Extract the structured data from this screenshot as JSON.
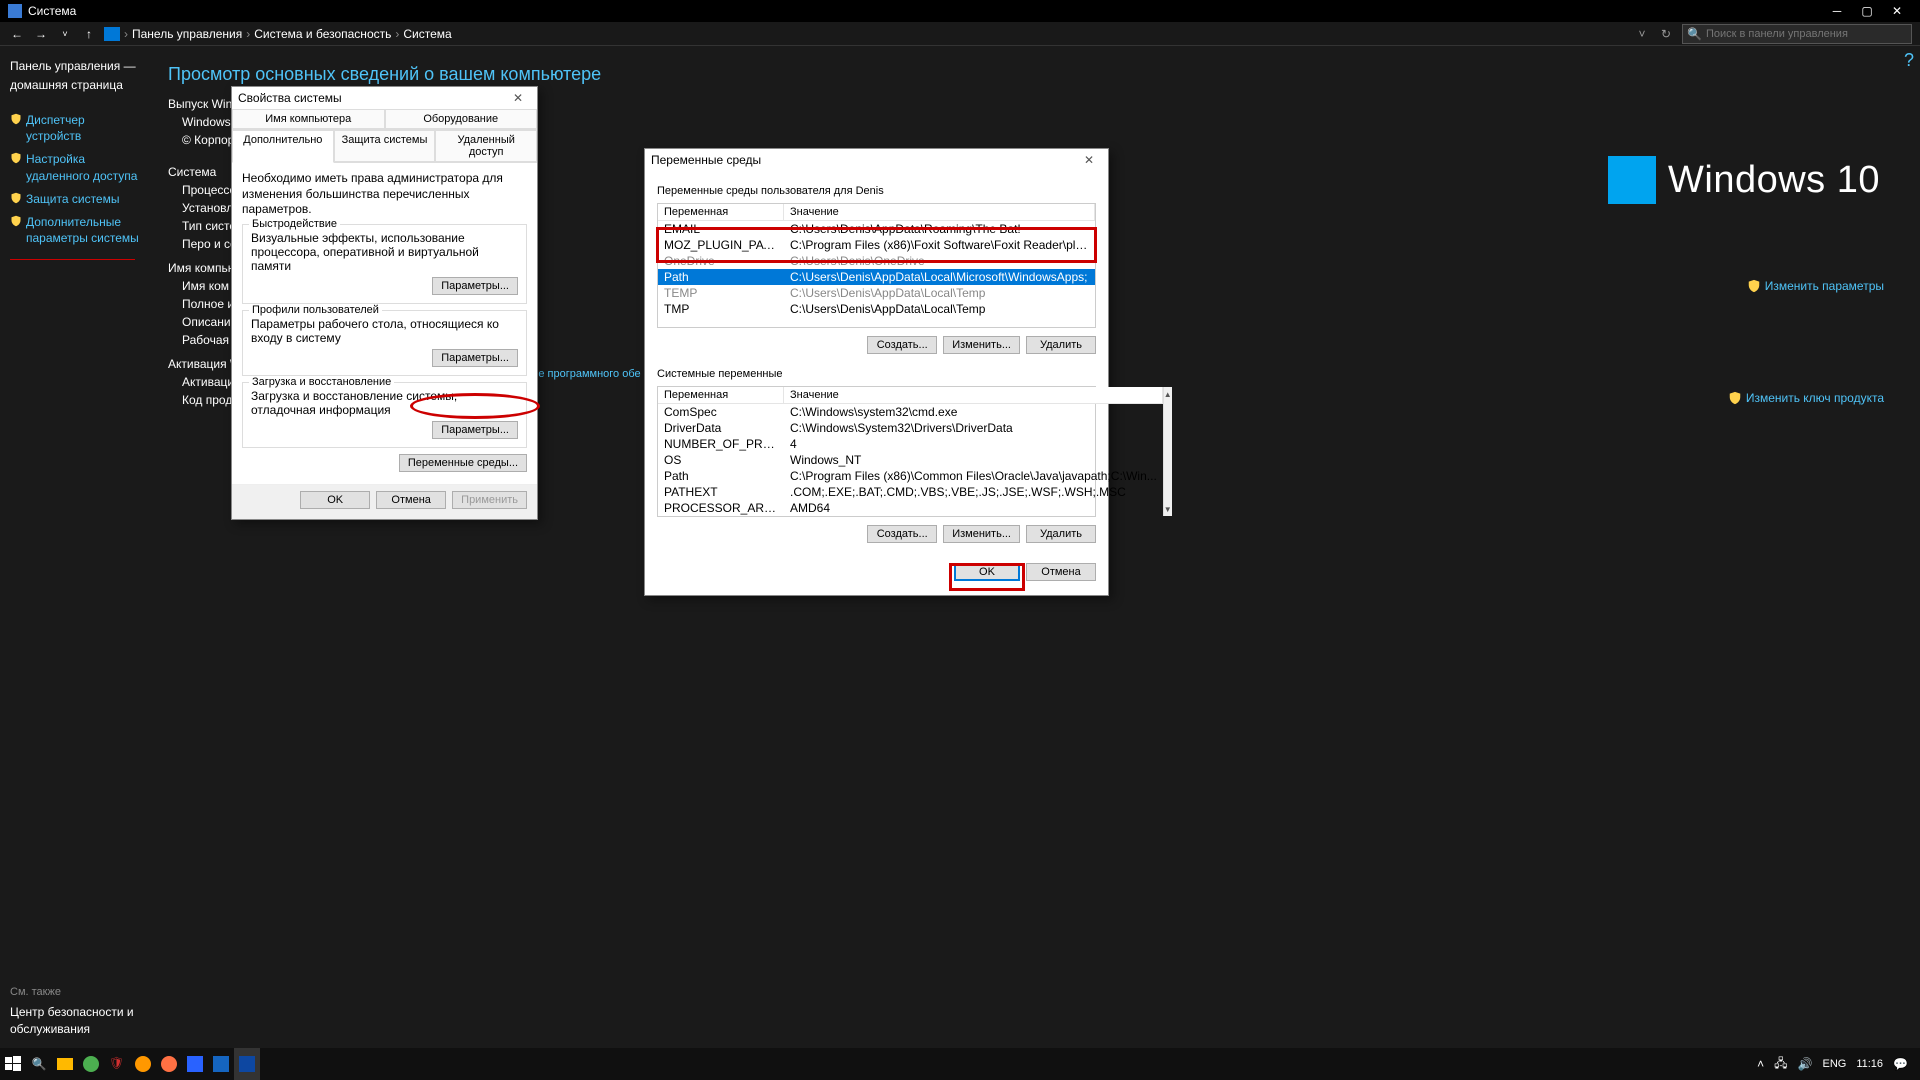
{
  "titlebar": {
    "title": "Система"
  },
  "breadcrumb": {
    "items": [
      "Панель управления",
      "Система и безопасность",
      "Система"
    ]
  },
  "search": {
    "placeholder": "Поиск в панели управления"
  },
  "sidebar": {
    "header1": "Панель управления —",
    "header2": "домашняя страница",
    "links": [
      "Диспетчер устройств",
      "Настройка удаленного доступа",
      "Защита системы",
      "Дополнительные параметры системы"
    ],
    "see_also": "См. также",
    "bottom_link": "Центр безопасности и обслуживания"
  },
  "page": {
    "heading": "Просмотр основных сведений о вашем компьютере",
    "section1": "Выпуск Windows",
    "win_line1": "Windows 1",
    "win_line2": "© Корпора",
    "section2": "Система",
    "sys_lines": [
      "Процессор",
      "Установлен (ОЗУ):",
      "Тип систем",
      "Перо и сен"
    ],
    "section3": "Имя компьют",
    "name_lines": [
      "Имя ком",
      "Полное и",
      "Описани",
      "Рабочая гр"
    ],
    "section4": "Активация W",
    "act_lines": [
      "Активация",
      "Код проду"
    ],
    "soft_text": "ание программного обе",
    "win_logo_text": "Windows 10",
    "action1": "Изменить параметры",
    "action2": "Изменить ключ продукта"
  },
  "dlg1": {
    "title": "Свойства системы",
    "tabs_row1": [
      "Имя компьютера",
      "Оборудование"
    ],
    "tabs_row2": [
      "Дополнительно",
      "Защита системы",
      "Удаленный доступ"
    ],
    "intro": "Необходимо иметь права администратора для изменения большинства перечисленных параметров.",
    "g1_title": "Быстродействие",
    "g1_text": "Визуальные эффекты, использование процессора, оперативной и виртуальной памяти",
    "g2_title": "Профили пользователей",
    "g2_text": "Параметры рабочего стола, относящиеся ко входу в систему",
    "g3_title": "Загрузка и восстановление",
    "g3_text": "Загрузка и восстановление системы, отладочная информация",
    "params_btn": "Параметры...",
    "env_btn": "Переменные среды...",
    "ok": "OK",
    "cancel": "Отмена",
    "apply": "Применить"
  },
  "dlg2": {
    "title": "Переменные среды",
    "user_group": "Переменные среды пользователя для Denis",
    "col_var": "Переменная",
    "col_val": "Значение",
    "user_vars": [
      {
        "name": "EMAIL",
        "value": "C:\\Users\\Denis\\AppData\\Roaming\\The Bat!"
      },
      {
        "name": "MOZ_PLUGIN_PATH",
        "value": "C:\\Program Files (x86)\\Foxit Software\\Foxit Reader\\plugins\\"
      },
      {
        "name": "OneDrive",
        "value": "C:\\Users\\Denis\\OneDrive"
      },
      {
        "name": "Path",
        "value": "C:\\Users\\Denis\\AppData\\Local\\Microsoft\\WindowsApps;"
      },
      {
        "name": "TEMP",
        "value": "C:\\Users\\Denis\\AppData\\Local\\Temp"
      },
      {
        "name": "TMP",
        "value": "C:\\Users\\Denis\\AppData\\Local\\Temp"
      }
    ],
    "sys_group": "Системные переменные",
    "sys_vars": [
      {
        "name": "ComSpec",
        "value": "C:\\Windows\\system32\\cmd.exe"
      },
      {
        "name": "DriverData",
        "value": "C:\\Windows\\System32\\Drivers\\DriverData"
      },
      {
        "name": "NUMBER_OF_PROCESSORS",
        "value": "4"
      },
      {
        "name": "OS",
        "value": "Windows_NT"
      },
      {
        "name": "Path",
        "value": "C:\\Program Files (x86)\\Common Files\\Oracle\\Java\\javapath;C:\\Win..."
      },
      {
        "name": "PATHEXT",
        "value": ".COM;.EXE;.BAT;.CMD;.VBS;.VBE;.JS;.JSE;.WSF;.WSH;.MSC"
      },
      {
        "name": "PROCESSOR_ARCHITECTURE",
        "value": "AMD64"
      }
    ],
    "new_btn": "Создать...",
    "edit_btn": "Изменить...",
    "del_btn": "Удалить",
    "ok": "OK",
    "cancel": "Отмена"
  },
  "tray": {
    "lang": "ENG",
    "time": "11:16"
  }
}
